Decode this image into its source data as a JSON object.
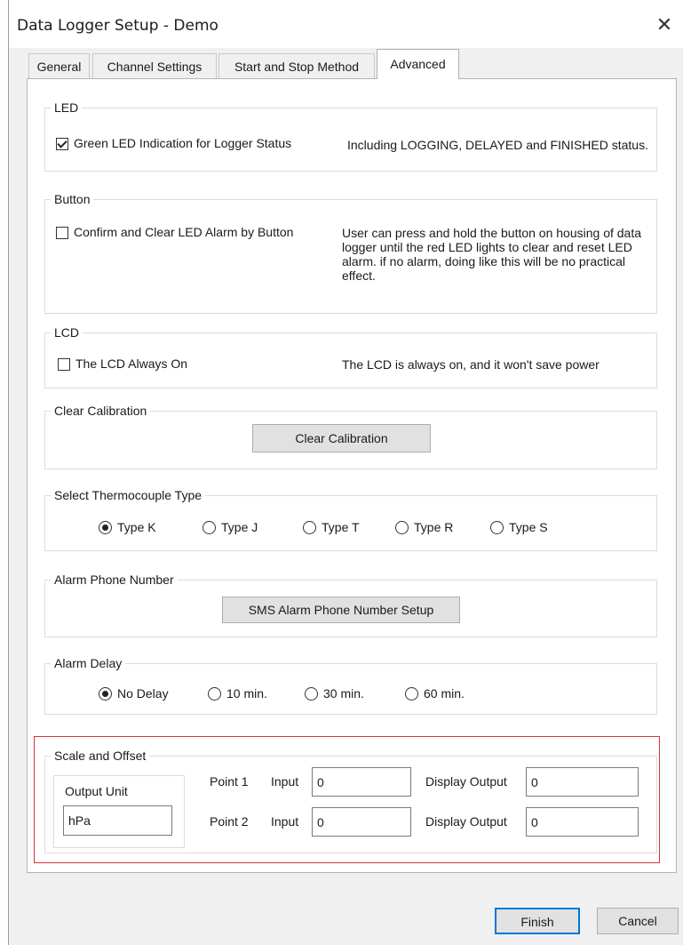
{
  "window": {
    "title": "Data Logger Setup - Demo",
    "close_glyph": "✕"
  },
  "tabs": [
    {
      "label": "General",
      "active": false
    },
    {
      "label": "Channel Settings",
      "active": false
    },
    {
      "label": "Start and Stop Method",
      "active": false
    },
    {
      "label": "Advanced",
      "active": true
    }
  ],
  "led": {
    "legend": "LED",
    "checkbox_label": "Green LED Indication for Logger Status",
    "checked": true,
    "description": "Including LOGGING, DELAYED and FINISHED status."
  },
  "button_group": {
    "legend": "Button",
    "checkbox_label": "Confirm and Clear LED Alarm by Button",
    "checked": false,
    "description": "User can press and hold the button on housing of data logger until the red LED lights to clear and reset LED alarm. if no alarm, doing like this will be no practical effect."
  },
  "lcd": {
    "legend": "LCD",
    "checkbox_label": "The LCD Always On",
    "checked": false,
    "description": "The LCD is always on, and it won't save power"
  },
  "clear_calibration": {
    "legend": "Clear Calibration",
    "button_label": "Clear Calibration"
  },
  "thermocouple": {
    "legend": "Select Thermocouple Type",
    "selected": "Type K",
    "options": [
      "Type K",
      "Type J",
      "Type T",
      "Type R",
      "Type S"
    ]
  },
  "alarm_phone": {
    "legend": "Alarm Phone Number",
    "button_label": "SMS Alarm Phone Number  Setup"
  },
  "alarm_delay": {
    "legend": "Alarm Delay",
    "selected": "No Delay",
    "options": [
      "No Delay",
      "10 min.",
      "30 min.",
      "60 min."
    ]
  },
  "scale_offset": {
    "legend": "Scale and Offset",
    "output_unit": {
      "legend": "Output Unit",
      "value": "hPa"
    },
    "point1": {
      "label": "Point 1",
      "input_label": "Input",
      "input_value": "0",
      "display_label": "Display Output",
      "display_value": "0"
    },
    "point2": {
      "label": "Point 2",
      "input_label": "Input",
      "input_value": "0",
      "display_label": "Display Output",
      "display_value": "0"
    }
  },
  "footer": {
    "finish_label": "Finish",
    "cancel_label": "Cancel"
  },
  "colors": {
    "highlight_border": "#d8343c",
    "default_button_border": "#0078d7"
  }
}
